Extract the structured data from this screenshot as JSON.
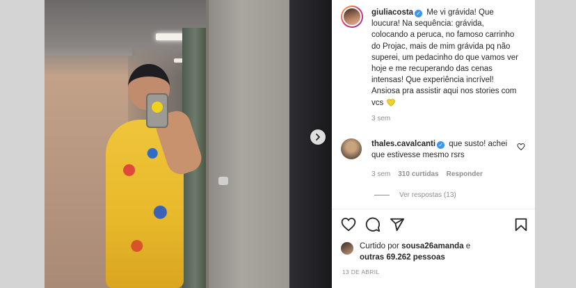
{
  "post": {
    "username": "giuliacosta",
    "caption": "Me vi grávida! Que loucura! Na sequência: grávida, colocando a peruca, no famoso carrinho do Projac, mais de mim grávida pq não superei, um pedacinho do que vamos ver hoje e me recuperando das cenas intensas! Que experiência incrível! Ansiosa pra assistir aqui nos stories com vcs",
    "caption_time": "3 sem",
    "date": "13 DE ABRIL"
  },
  "comment": {
    "username": "thales.cavalcanti",
    "text": "que susto! achei que estivesse mesmo rsrs",
    "time": "3 sem",
    "likes": "310 curtidas",
    "reply_label": "Responder",
    "view_replies": "Ver respostas (13)"
  },
  "likes": {
    "prefix": "Curtido por",
    "user": "sousa26amanda",
    "connector": "e",
    "others": "outras 69.262 pessoas"
  },
  "icons": {
    "carousel_next": "chevron-right-icon",
    "like": "heart-icon",
    "comment": "comment-icon",
    "share": "paper-plane-icon",
    "save": "bookmark-icon",
    "verified": "verified-badge-icon",
    "caption_emoji": "yellow-heart-emoji"
  },
  "colors": {
    "accent_verified": "#3897f0",
    "muted_text": "#8e8e8e",
    "emoji_yellow": "#f7d21d"
  }
}
